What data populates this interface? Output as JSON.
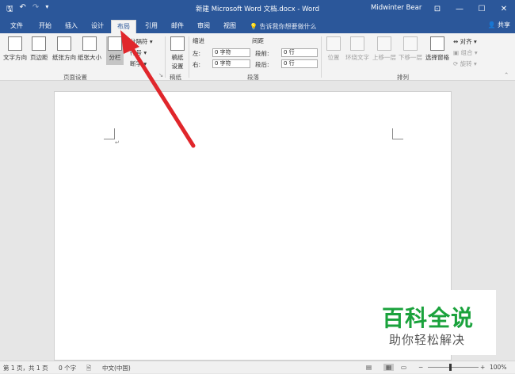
{
  "titlebar": {
    "doc_title": "新建 Microsoft Word 文档.docx - Word",
    "user": "Midwinter Bear",
    "win_min": "—",
    "win_max": "☐",
    "win_close": "✕"
  },
  "tabs": {
    "file": "文件",
    "home": "开始",
    "insert": "插入",
    "design": "设计",
    "layout": "布局",
    "references": "引用",
    "mailings": "邮件",
    "review": "审阅",
    "view": "视图",
    "tellme": "告诉我你想要做什么",
    "share": "共享"
  },
  "ribbon": {
    "text_direction": "文字方向",
    "margins": "页边距",
    "orientation": "纸张方向",
    "size": "纸张大小",
    "columns": "分栏",
    "breaks": "分隔符",
    "line_numbers": "行号",
    "hyphenation": "断字",
    "page_setup_group": "页面设置",
    "draft_setup": "稿纸设置",
    "draft_group": "稿纸",
    "indent_header": "缩进",
    "spacing_header": "间距",
    "indent_left_label": "左:",
    "indent_left_value": "0 字符",
    "indent_right_label": "右:",
    "indent_right_value": "0 字符",
    "space_before_label": "段前:",
    "space_before_value": "0 行",
    "space_after_label": "段后:",
    "space_after_value": "0 行",
    "paragraph_group": "段落",
    "position": "位置",
    "wrap_text": "环绕文字",
    "bring_forward": "上移一层",
    "send_backward": "下移一层",
    "selection_pane": "选择窗格",
    "align": "对齐",
    "group": "组合",
    "rotate": "旋转",
    "arrange_group": "排列"
  },
  "status": {
    "page": "第 1 页，共 1 页",
    "words": "0 个字",
    "language": "中文(中国)",
    "zoom": "100%"
  },
  "watermark": {
    "title": "百科全说",
    "subtitle": "助你轻松解决"
  },
  "colors": {
    "word_blue": "#2b579a",
    "arrow_red": "#e0262b",
    "watermark_green": "#1aa23c"
  }
}
